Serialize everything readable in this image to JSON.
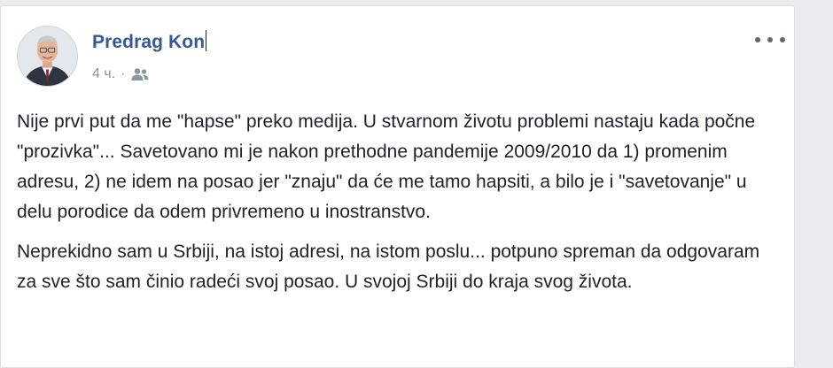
{
  "post": {
    "author": "Predrag Kon",
    "time": "4 ч.",
    "separator": "·",
    "audience_icon": "friends-icon",
    "more_icon": "more-options-icon",
    "paragraphs": [
      "Nije prvi put da me \"hapse\" preko medija. U stvarnom životu problemi nastaju kada počne \"prozivka\"... Savetovano mi je nakon prethodne pandemije 2009/2010 da 1) promenim adresu, 2) ne idem na posao jer \"znaju\" da će me tamo hapsiti, a bilo je i \"savetovanje\" u delu porodice da odem privremeno u inostranstvo.",
      "Neprekidno sam u Srbiji, na istoj adresi, na istom poslu... potpuno spreman da odgovaram za sve što sam činio radeći svoj posao. U svojoj Srbiji do kraja svog života."
    ]
  },
  "colors": {
    "name": "#365899",
    "meta": "#90949c",
    "text": "#1d2129",
    "background": "#e9ebee"
  }
}
